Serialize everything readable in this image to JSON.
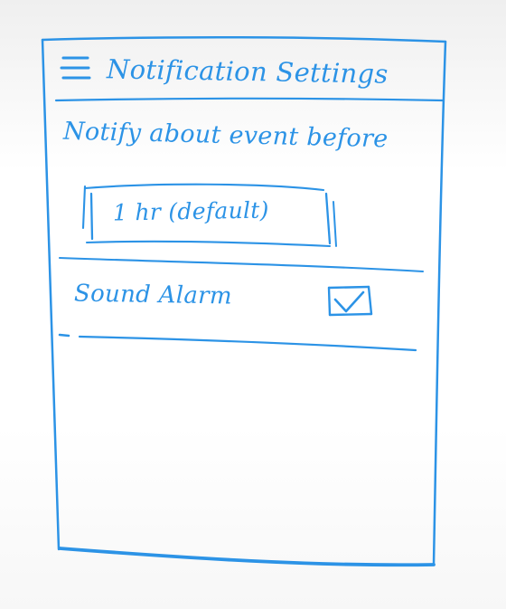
{
  "header": {
    "title": "Notification Settings",
    "menu_icon": "hamburger-menu-icon"
  },
  "notify": {
    "label": "Notify about event before",
    "selected_value": "1 hr (default)"
  },
  "sound_alarm": {
    "label": "Sound Alarm",
    "checked": true
  },
  "ink_color": "#2c93e6"
}
